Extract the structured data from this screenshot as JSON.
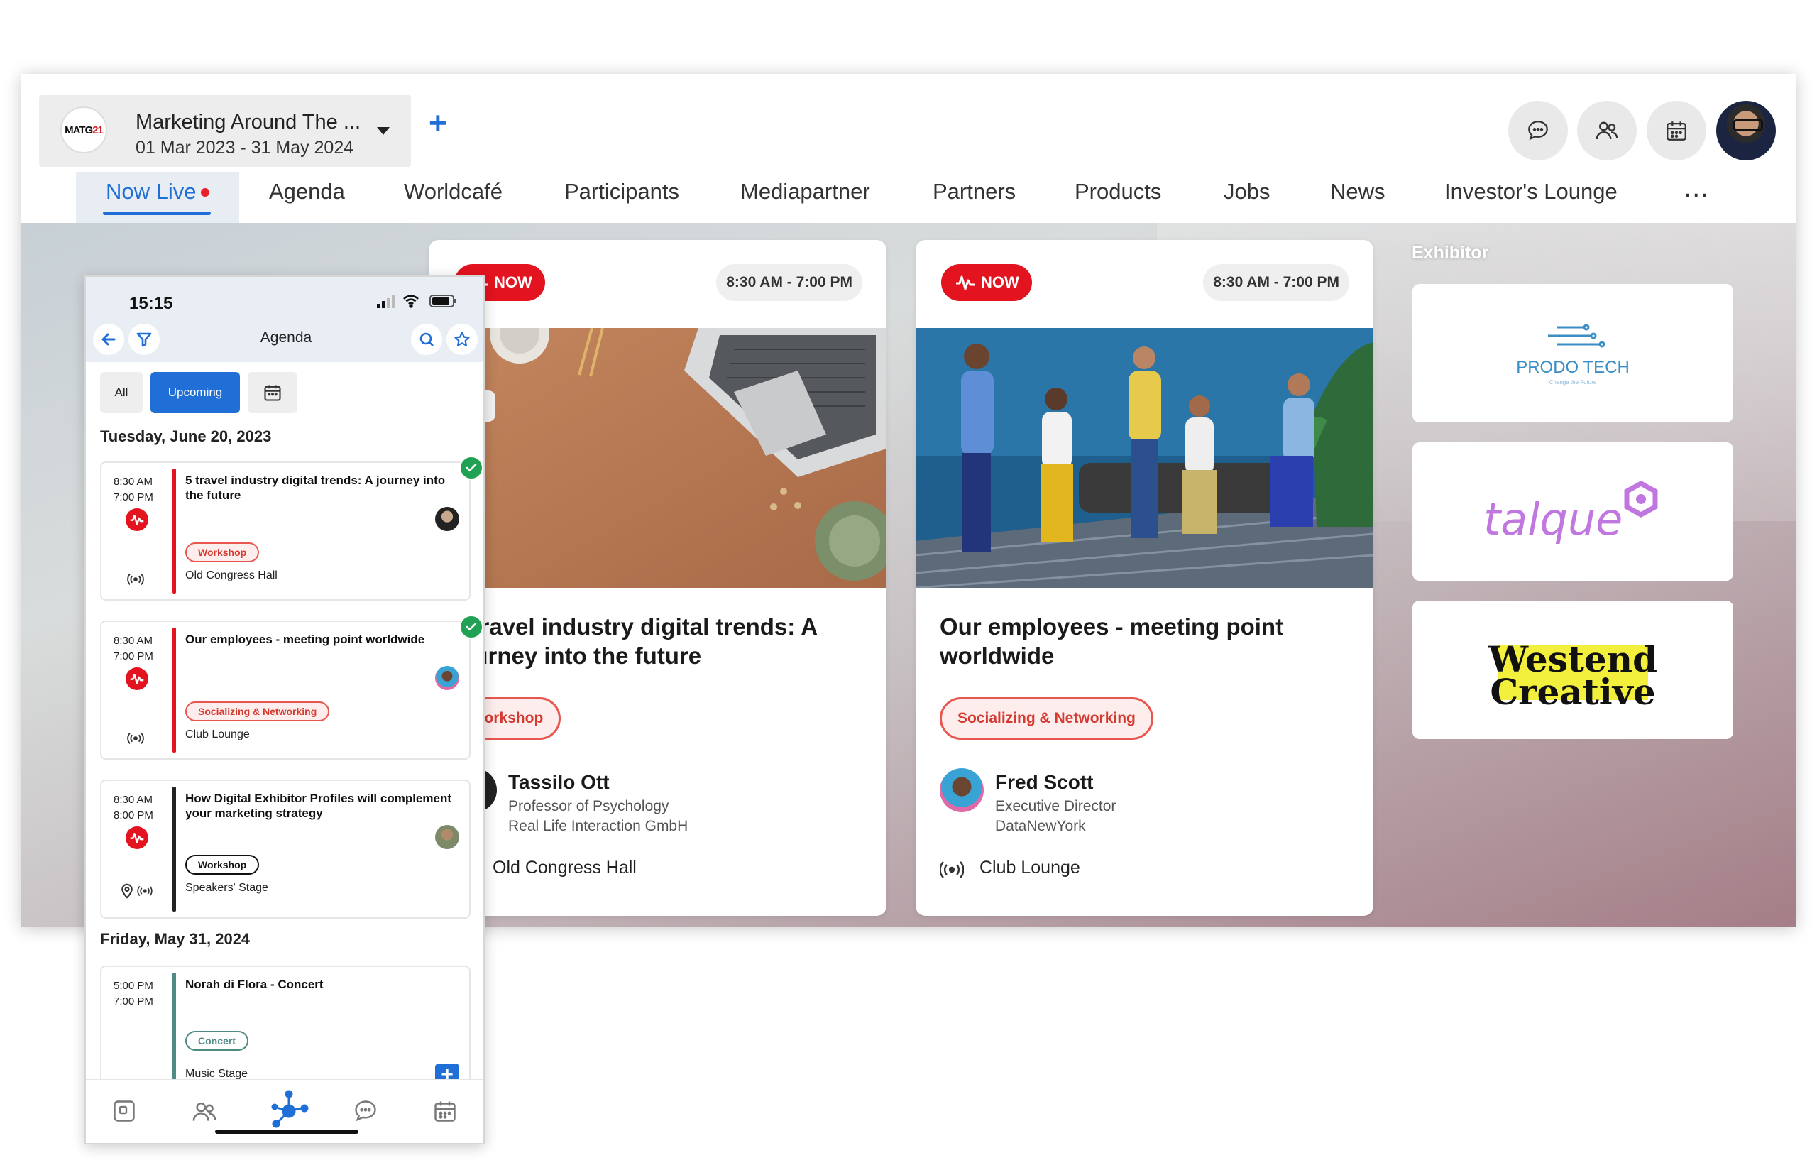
{
  "colors": {
    "accent": "#1f6fd6",
    "live": "#e3131f",
    "success": "#21a153",
    "tag_red": "#e8564e"
  },
  "event": {
    "logo_prefix": "MATG",
    "logo_suffix": "21",
    "title": "Marketing Around The ...",
    "dates": "01 Mar 2023 - 31 May 2024",
    "add_label": "+"
  },
  "header_icons": [
    "chat-bubble-icon",
    "people-icon",
    "calendar-icon"
  ],
  "nav": {
    "items": [
      "Now Live",
      "Agenda",
      "Worldcafé",
      "Participants",
      "Mediapartner",
      "Partners",
      "Products",
      "Jobs",
      "News",
      "Investor's Lounge"
    ],
    "active": "Now Live",
    "more_label": "..."
  },
  "sessions": [
    {
      "badge": "NOW",
      "time": "8:30 AM - 7:00 PM",
      "title": "5 travel industry digital trends: A journey into the future",
      "tag": "Workshop",
      "speaker": {
        "name": "Tassilo Ott",
        "role": "Professor of Psychology",
        "org": "Real Life Interaction GmbH"
      },
      "room": "Old Congress Hall"
    },
    {
      "badge": "NOW",
      "time": "8:30 AM - 7:00 PM",
      "title": "Our employees - meeting point worldwide",
      "tag": "Socializing & Networking",
      "speaker": {
        "name": "Fred Scott",
        "role": "Executive Director",
        "org": "DataNewYork"
      },
      "room": "Club Lounge"
    }
  ],
  "exhibitors": {
    "label": "Exhibitor",
    "items": [
      {
        "name": "PRODO TECH",
        "tagline": "Change the Future"
      },
      {
        "name": "talque"
      },
      {
        "name": "Westend Creative",
        "line1": "Westend",
        "line2": "Creative"
      }
    ]
  },
  "phone": {
    "status_time": "15:15",
    "header_title": "Agenda",
    "filters": {
      "all": "All",
      "upcoming": "Upcoming",
      "active": "Upcoming"
    },
    "days": [
      {
        "date": "Tuesday, June 20, 2023",
        "events": [
          {
            "start": "8:30 AM",
            "end": "7:00 PM",
            "title": "5 travel industry digital trends: A journey into the future",
            "tag": "Workshop",
            "room": "Old Congress Hall",
            "checked": true,
            "live": true
          },
          {
            "start": "8:30 AM",
            "end": "7:00 PM",
            "title": "Our employees - meeting point worldwide",
            "tag": "Socializing & Networking",
            "room": "Club Lounge",
            "checked": true,
            "live": true
          },
          {
            "start": "8:30 AM",
            "end": "8:00 PM",
            "title": "How Digital Exhibitor Profiles will complement your marketing strategy",
            "tag": "Workshop",
            "room": "Speakers' Stage",
            "checked": false,
            "live": true
          }
        ]
      },
      {
        "date": "Friday, May 31, 2024",
        "events": [
          {
            "start": "5:00 PM",
            "end": "7:00 PM",
            "title": "Norah di Flora - Concert",
            "tag": "Concert",
            "room": "Music Stage",
            "checked": false,
            "live": false
          }
        ]
      }
    ],
    "tabs": [
      "home-icon",
      "people-icon",
      "network-icon",
      "chat-bubble-icon",
      "calendar-icon"
    ],
    "add_label": "+"
  }
}
